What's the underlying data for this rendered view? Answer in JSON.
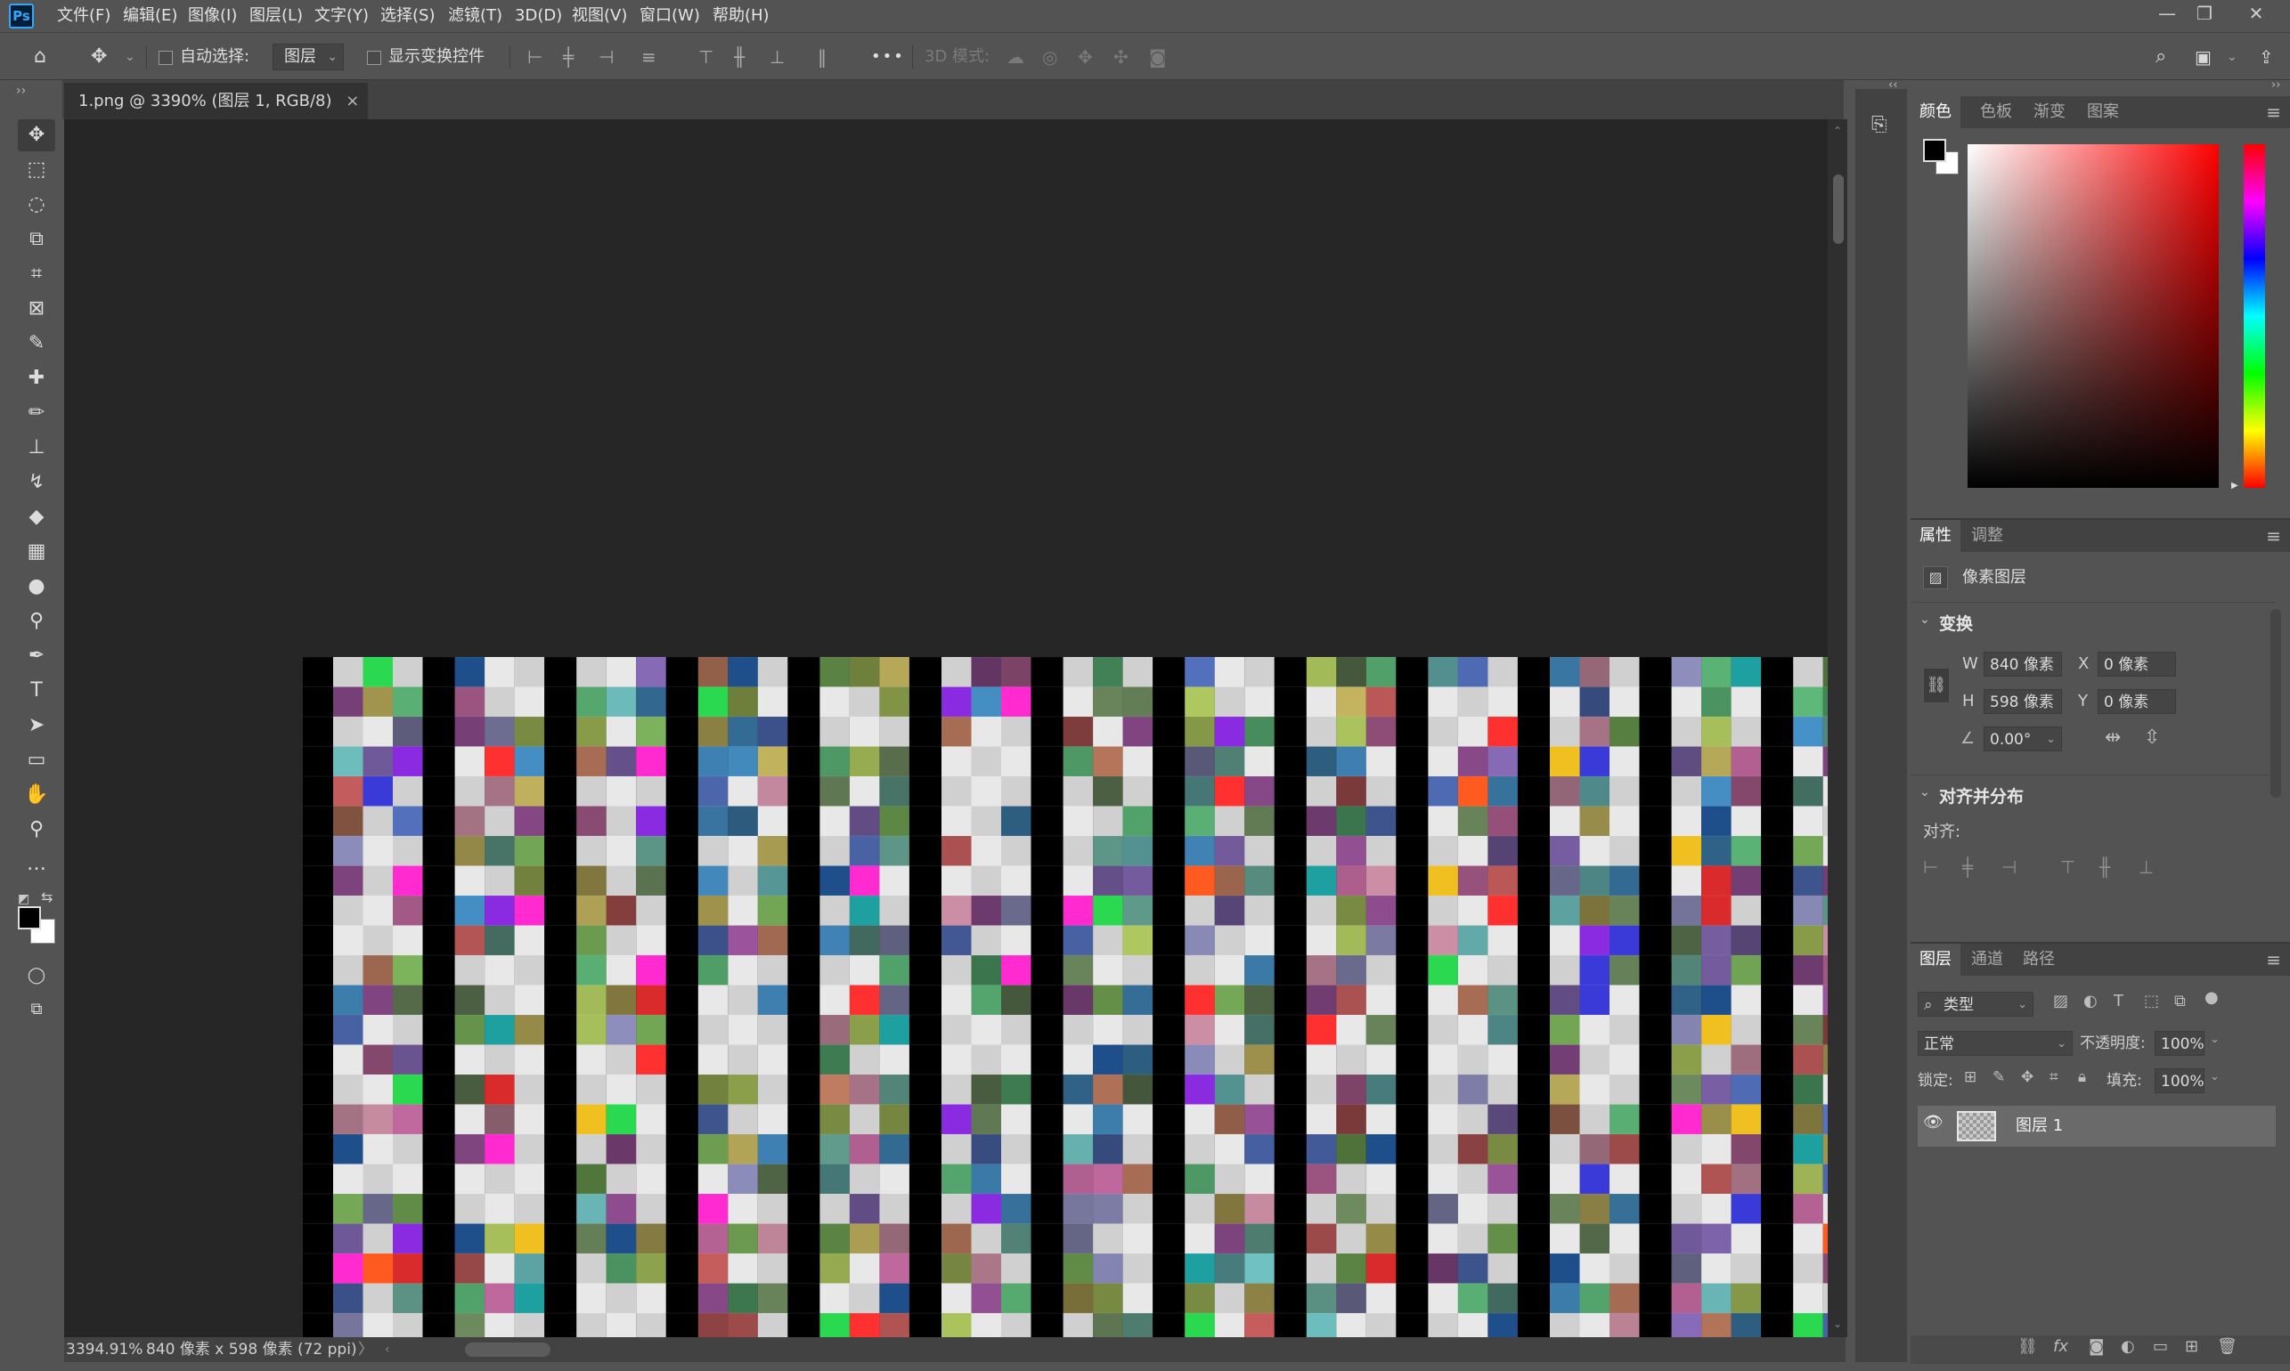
{
  "app": {
    "logo": "Ps",
    "menus": [
      "文件(F)",
      "编辑(E)",
      "图像(I)",
      "图层(L)",
      "文字(Y)",
      "选择(S)",
      "滤镜(T)",
      "3D(D)",
      "视图(V)",
      "窗口(W)",
      "帮助(H)"
    ],
    "window_controls": [
      "—",
      "❐",
      "✕"
    ]
  },
  "options": {
    "auto_select_label": "自动选择:",
    "auto_select_target": "图层",
    "show_transform_label": "显示变换控件",
    "more_label": "•••",
    "mode3d_label": "3D 模式:"
  },
  "document": {
    "tab_title": "1.png @ 3390% (图层 1, RGB/8)",
    "tab_close": "×"
  },
  "status": {
    "zoom": "3394.91%",
    "doc_info": "840 像素 x 598 像素 (72 ppi)",
    "arrow": "〉"
  },
  "color_panel": {
    "tabs": [
      "颜色",
      "色板",
      "渐变",
      "图案"
    ],
    "active_tab": 0,
    "foreground": "#000000",
    "background": "#ffffff",
    "hue_color": "#ff0000"
  },
  "properties_panel": {
    "tabs": [
      "属性",
      "调整"
    ],
    "layer_type": "像素图层",
    "transform_title": "变换",
    "w_label": "W",
    "w_value": "840 像素",
    "h_label": "H",
    "h_value": "598 像素",
    "x_label": "X",
    "x_value": "0 像素",
    "y_label": "Y",
    "y_value": "0 像素",
    "angle_value": "0.00°",
    "align_title": "对齐并分布",
    "align_label": "对齐:"
  },
  "layers_panel": {
    "tabs": [
      "图层",
      "通道",
      "路径"
    ],
    "filter_kind": "类型",
    "blend_mode": "正常",
    "opacity_label": "不透明度:",
    "opacity_value": "100%",
    "lock_label": "锁定:",
    "fill_label": "填充:",
    "fill_value": "100%",
    "layers": [
      {
        "name": "图层 1",
        "visible": true,
        "selected": true
      }
    ]
  }
}
